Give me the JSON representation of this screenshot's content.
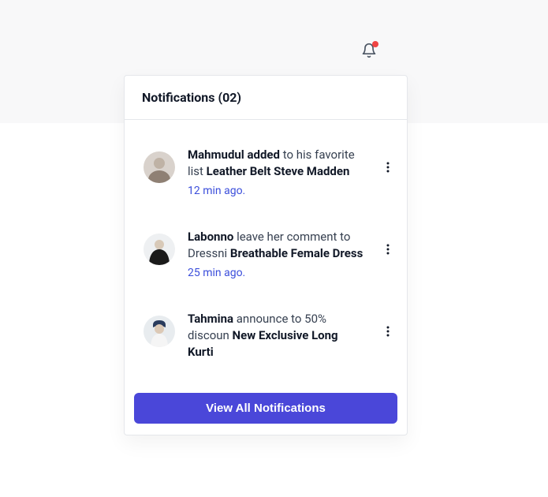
{
  "header": {
    "title": "Notifications (02)"
  },
  "notifications": [
    {
      "actor": "Mahmudul",
      "action": "added",
      "middle": " to his favorite list ",
      "target": "Leather Belt Steve Madden",
      "time": "12 min ago."
    },
    {
      "actor": "Labonno",
      "action": "",
      "middle": " leave her comment to Dressni ",
      "target": "Breathable Female Dress",
      "time": "25 min ago."
    },
    {
      "actor": "Tahmina",
      "action": "",
      "middle": " announce to 50% discoun ",
      "target": "New Exclusive Long Kurti",
      "time": ""
    }
  ],
  "footer": {
    "view_all": "View All Notifications"
  }
}
